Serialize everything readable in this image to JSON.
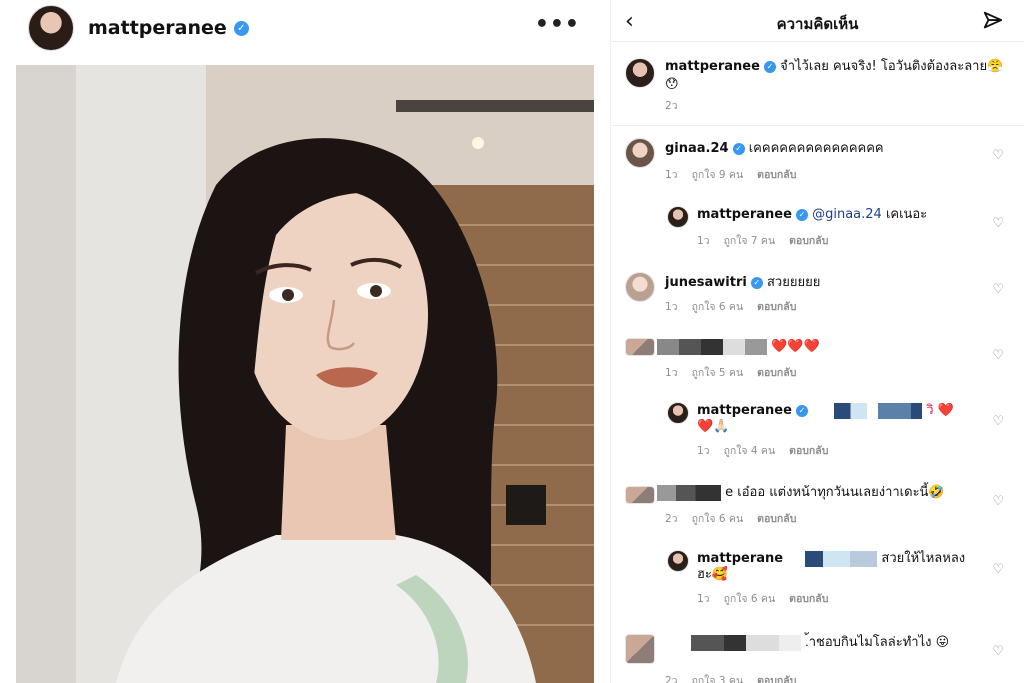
{
  "post": {
    "username": "mattperanee",
    "verified_mark": "✓",
    "more_icon": "•••"
  },
  "comments_panel": {
    "title": "ความคิดเห็น",
    "back_icon": "‹",
    "send_icon": "send-icon",
    "caption": {
      "username": "mattperanee",
      "text": "จำไว้เลย คนจริง! โอวันติงต้องละลาย😤",
      "text2": "😯",
      "time": "2ว"
    },
    "items": [
      {
        "username": "ginaa.24",
        "text": "เคคคคคคคคคคคคคคค",
        "time": "1ว",
        "likes": "ถูกใจ 9 คน",
        "reply": "ตอบกลับ"
      },
      {
        "username": "mattperanee",
        "mention": "@ginaa.24",
        "text": "เคเนอะ",
        "time": "1ว",
        "likes": "ถูกใจ 7 คน",
        "reply": "ตอบกลับ"
      },
      {
        "username": "junesawitri",
        "text": "สวยยยยย",
        "time": "1ว",
        "likes": "ถูกใจ 6 คน",
        "reply": "ตอบกลับ"
      },
      {
        "username": "",
        "text": "❤️❤️❤️",
        "time": "1ว",
        "likes": "ถูกใจ 5 คน",
        "reply": "ตอบกลับ"
      },
      {
        "username": "mattperanee",
        "text": "วิ ❤️",
        "text2": "❤️🙏🏻",
        "time": "1ว",
        "likes": "ถูกใจ 4 คน",
        "reply": "ตอบกลับ"
      },
      {
        "username": "",
        "text": "e เอ๋ออ แต่งหน้าทุกวันนเลยง่าาเดะนี้🤣",
        "time": "2ว",
        "likes": "ถูกใจ 6 คน",
        "reply": "ตอบกลับ"
      },
      {
        "username": "mattperane",
        "text": "สวยให้ไหลหลง",
        "text2": "ฮะ🥰",
        "time": "1ว",
        "likes": "ถูกใจ 6 คน",
        "reply": "ตอบกลับ"
      },
      {
        "username": "",
        "text": ".้าชอบกินไมโลล่ะทำไง 😛",
        "time": "2ว",
        "likes": "ถูกใจ 3 คน",
        "reply": "ตอบกลับ"
      }
    ],
    "heart_icon": "♡"
  }
}
